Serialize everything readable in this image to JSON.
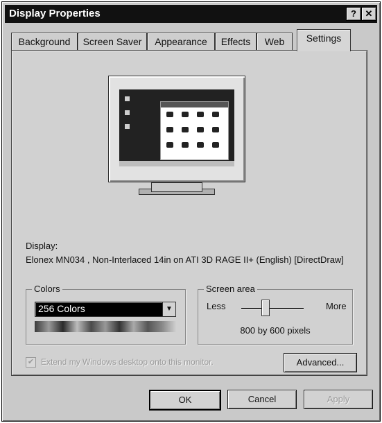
{
  "window": {
    "title": "Display Properties",
    "help_label": "?",
    "close_label": "✕"
  },
  "tabs": [
    {
      "label": "Background"
    },
    {
      "label": "Screen Saver"
    },
    {
      "label": "Appearance"
    },
    {
      "label": "Effects"
    },
    {
      "label": "Web"
    },
    {
      "label": "Settings"
    }
  ],
  "active_tab": "Settings",
  "display": {
    "label": "Display:",
    "description": "Elonex MN034 , Non-Interlaced 14in on ATI 3D RAGE II+ (English) [DirectDraw]"
  },
  "colors": {
    "group_label": "Colors",
    "selected": "256 Colors",
    "arrow": "▼"
  },
  "screen_area": {
    "group_label": "Screen area",
    "less_label": "Less",
    "more_label": "More",
    "resolution": "800 by 600 pixels",
    "slider_level": 0.38
  },
  "extend": {
    "checked": true,
    "label": "Extend my Windows desktop onto this monitor.",
    "enabled": false,
    "mark": "✔"
  },
  "buttons": {
    "advanced": "Advanced...",
    "ok": "OK",
    "cancel": "Cancel",
    "apply": "Apply"
  }
}
